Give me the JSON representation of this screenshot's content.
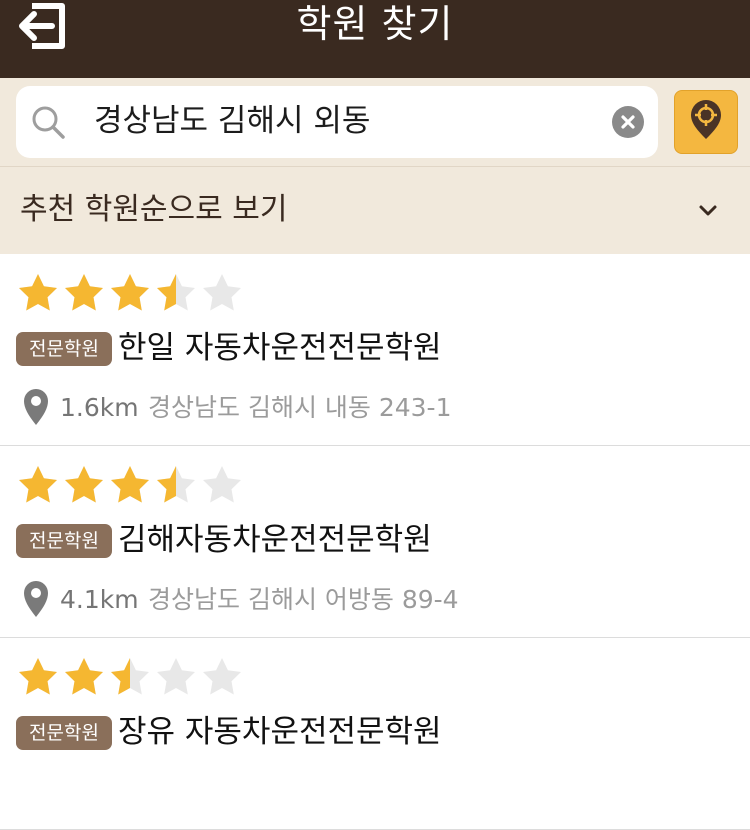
{
  "header": {
    "title": "학원 찾기",
    "back_icon": "back-exit-icon"
  },
  "search": {
    "value": "경상남도 김해시 외동",
    "icons": [
      "search-icon",
      "clear-icon",
      "locate-pin-icon"
    ]
  },
  "sort": {
    "label": "추천 학원순으로 보기",
    "icon": "chevron-down-icon"
  },
  "academies": [
    {
      "rating": 3.5,
      "rating_max": 5,
      "badge": "전문학원",
      "name": "한일 자동차운전전문학원",
      "distance": "1.6km",
      "address": "경상남도 김해시 내동 243-1"
    },
    {
      "rating": 3.5,
      "rating_max": 5,
      "badge": "전문학원",
      "name": "김해자동차운전전문학원",
      "distance": "4.1km",
      "address": "경상남도 김해시 어방동 89-4"
    },
    {
      "rating": 2.5,
      "rating_max": 5,
      "badge": "전문학원",
      "name": "장유 자동차운전전문학원"
    }
  ],
  "colors": {
    "header_bg": "#3a2a20",
    "panel_bg": "#f1e9dc",
    "star_filled": "#f5b731",
    "star_empty": "#e8e8e8",
    "badge_bg": "#8a6f5a",
    "locate_btn": "#f4b740"
  }
}
